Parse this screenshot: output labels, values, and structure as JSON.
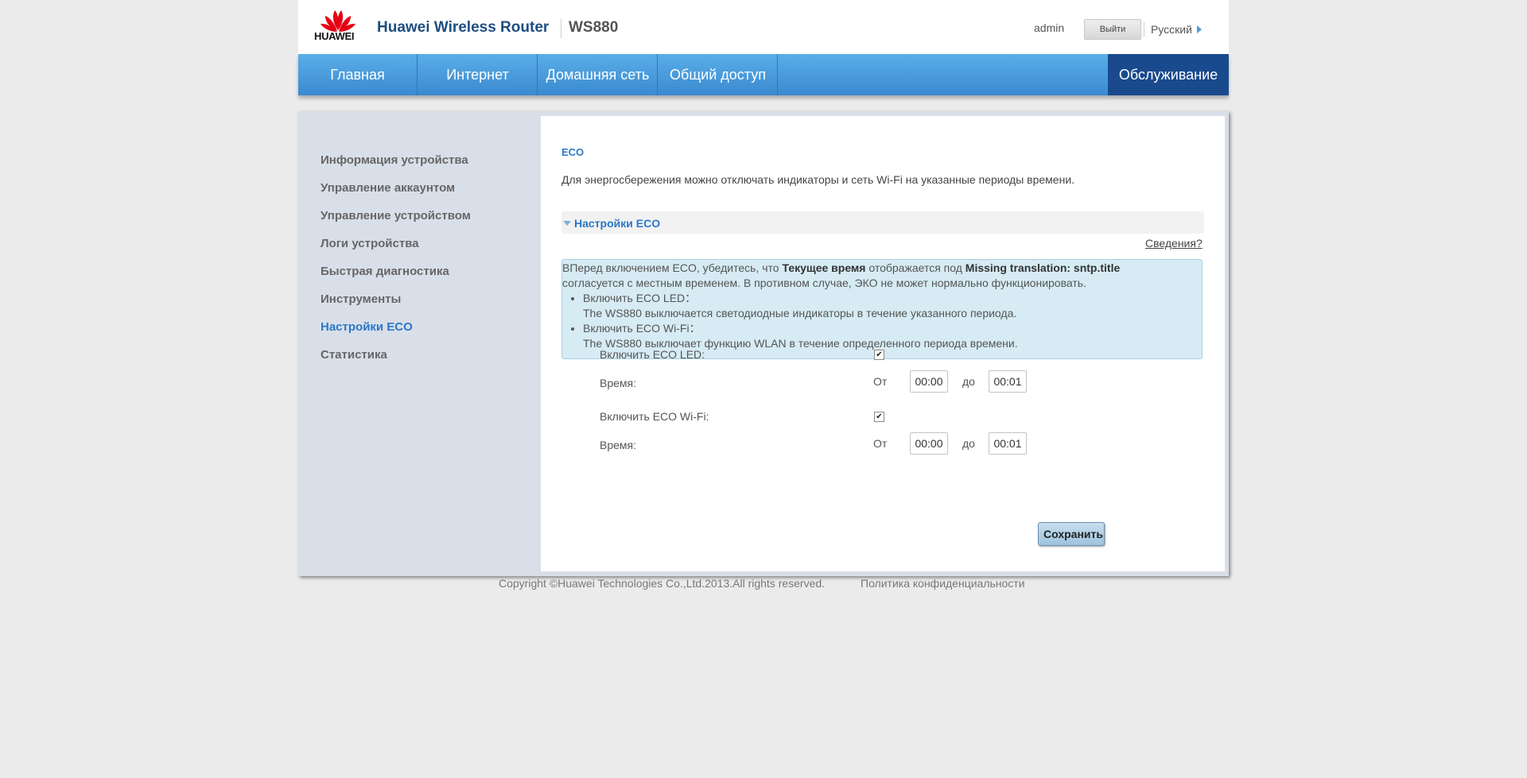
{
  "header": {
    "logo_text": "HUAWEI",
    "product_title": "Huawei Wireless Router",
    "model": "WS880",
    "user": "admin",
    "logout_label": "Выйти",
    "language": "Русский"
  },
  "nav": {
    "items": [
      {
        "label": "Главная"
      },
      {
        "label": "Интернет"
      },
      {
        "label": "Домашняя сеть"
      },
      {
        "label": "Общий доступ"
      },
      {
        "label": "Обслуживание"
      }
    ]
  },
  "sidebar": {
    "items": [
      {
        "label": "Информация устройства"
      },
      {
        "label": "Управление аккаунтом"
      },
      {
        "label": "Управление устройством"
      },
      {
        "label": "Логи устройства"
      },
      {
        "label": "Быстрая диагностика"
      },
      {
        "label": "Инструменты"
      },
      {
        "label": "Настройки ECO"
      },
      {
        "label": "Статистика"
      }
    ]
  },
  "main": {
    "title": "ECO",
    "description": "Для энергосбережения можно отключать индикаторы и сеть Wi-Fi на указанные периоды времени.",
    "section_title": "Настройки ECO",
    "details_link": "Сведения?",
    "info": {
      "line1_a": "ВПеред включением ECO, убедитесь, что ",
      "line1_b": "Текущее время",
      "line1_c": " отображается под ",
      "line1_d": "Missing translation: sntp.title",
      "line2": "согласуется с местным временем. В противном случае, ЭКО не может нормально функционировать.",
      "bullet1_title": "Включить ECO LED：",
      "bullet1_text": "The WS880 выключается светодиодные индикаторы в течение указанного периода.",
      "bullet2_title": "Включить ECO Wi-Fi：",
      "bullet2_text": "The WS880 выключает функцию WLAN в течение определенного периода времени."
    },
    "form": {
      "led_label": "Включить ECO LED:",
      "led_checked_mark": "✔",
      "led_time_label": "Время:",
      "led_from_label": "От",
      "led_from": "00:00",
      "led_to_label": "до",
      "led_to": "00:01",
      "wifi_label": "Включить ECO Wi-Fi:",
      "wifi_checked_mark": "✔",
      "wifi_time_label": "Время:",
      "wifi_from_label": "От",
      "wifi_from": "00:00",
      "wifi_to_label": "до",
      "wifi_to": "00:01",
      "save_label": "Сохранить"
    }
  },
  "footer": {
    "copyright": "Copyright ©Huawei Technologies Co.,Ltd.2013.All rights reserved.",
    "privacy": "Политика конфиденциальности"
  },
  "colors": {
    "nav_gradient_top": "#5aaee8",
    "nav_active": "#1a4a8e",
    "accent_blue": "#2b78c8",
    "brand_red": "#e60012"
  }
}
